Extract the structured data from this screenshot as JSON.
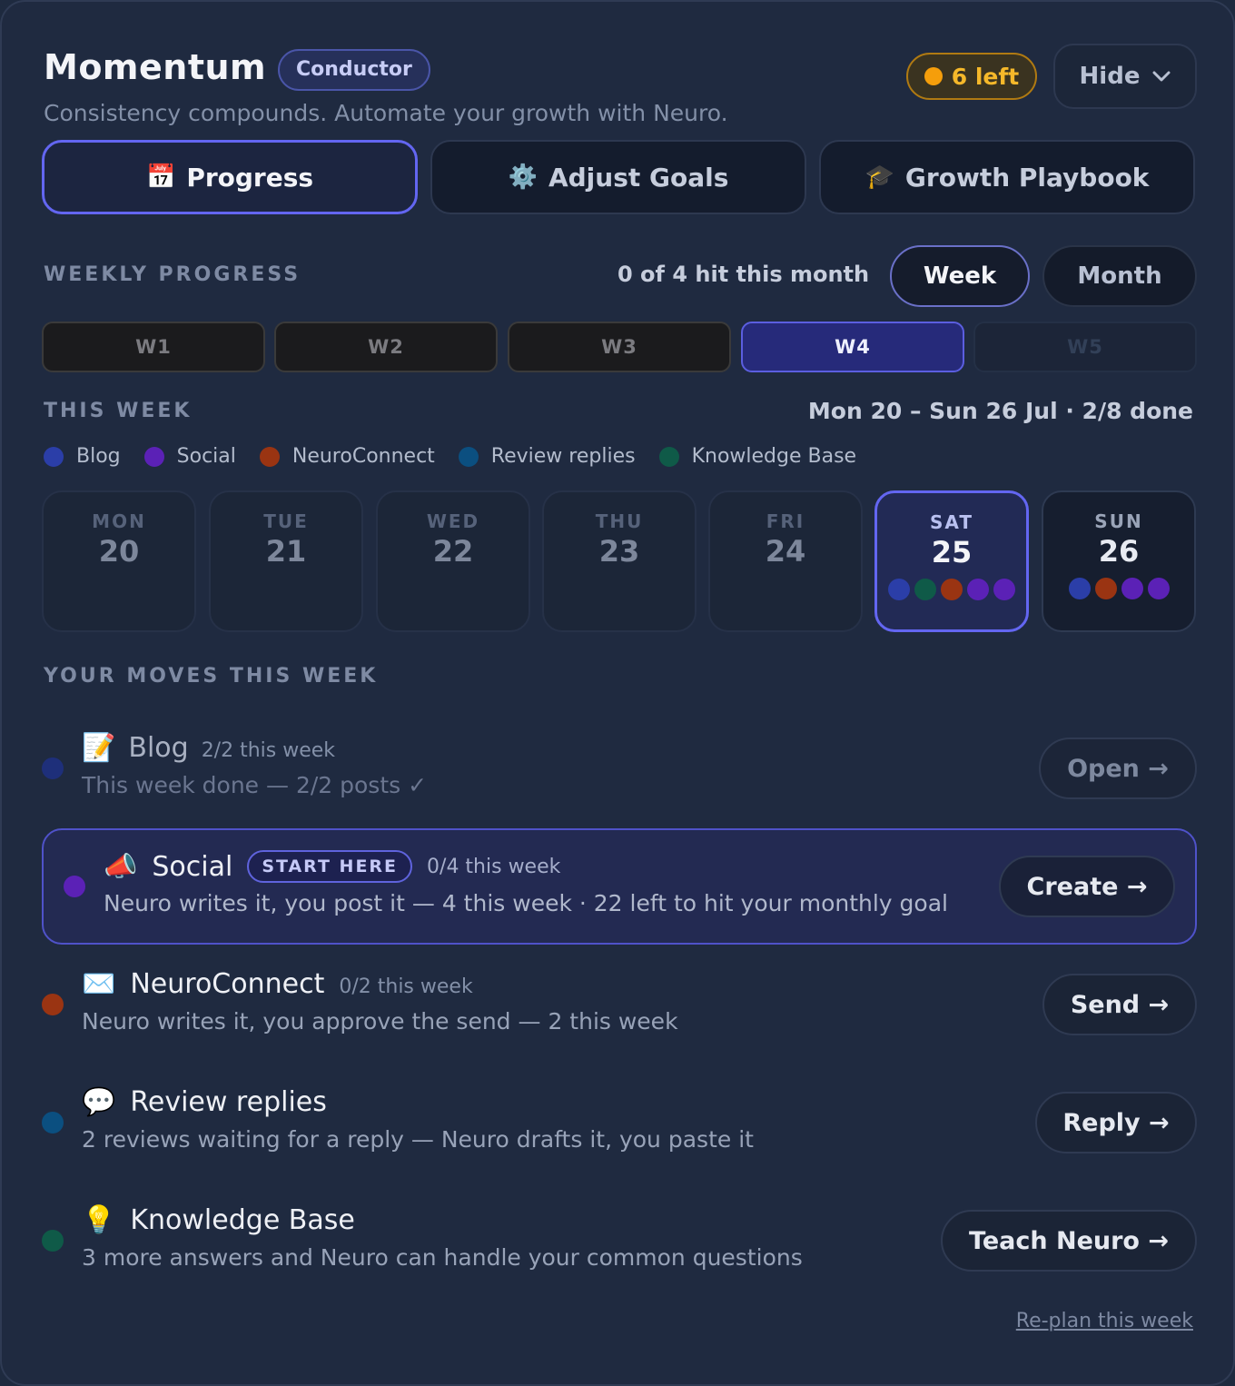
{
  "header": {
    "title": "Momentum",
    "role_badge": "Conductor",
    "subtitle": "Consistency compounds. Automate your growth with Neuro.",
    "left_badge": "6 left",
    "hide_label": "Hide"
  },
  "tabs": [
    {
      "label": "Progress",
      "icon": "📅",
      "active": true
    },
    {
      "label": "Adjust Goals",
      "icon": "⚙️",
      "active": false
    },
    {
      "label": "Growth Playbook",
      "icon": "🎓",
      "active": false
    }
  ],
  "weekly": {
    "label": "WEEKLY PROGRESS",
    "hit_text": "0 of 4 hit this month",
    "toggle_week": "Week",
    "toggle_month": "Month",
    "weeks": [
      "W1",
      "W2",
      "W3",
      "W4",
      "W5"
    ],
    "active_week": "W4"
  },
  "this_week": {
    "label": "THIS WEEK",
    "range": "Mon 20 – Sun 26 Jul · 2/8 done",
    "legend": [
      {
        "label": "Blog",
        "color": "#2b3ea8"
      },
      {
        "label": "Social",
        "color": "#5b21b6"
      },
      {
        "label": "NeuroConnect",
        "color": "#9a3412"
      },
      {
        "label": "Review replies",
        "color": "#0b4f80"
      },
      {
        "label": "Knowledge Base",
        "color": "#0f5a48"
      }
    ],
    "days": [
      {
        "name": "MON",
        "num": "20"
      },
      {
        "name": "TUE",
        "num": "21"
      },
      {
        "name": "WED",
        "num": "22"
      },
      {
        "name": "THU",
        "num": "23"
      },
      {
        "name": "FRI",
        "num": "24"
      },
      {
        "name": "SAT",
        "num": "25"
      },
      {
        "name": "SUN",
        "num": "26"
      }
    ]
  },
  "moves": {
    "label": "YOUR MOVES THIS WEEK",
    "items": [
      {
        "icon": "📝",
        "title": "Blog",
        "count": "2/2 this week",
        "desc": "This week done — 2/2 posts ✓",
        "cta": "Open →",
        "color": "#1e2f7a"
      },
      {
        "icon": "📣",
        "title": "Social",
        "badge": "START HERE",
        "count": "0/4 this week",
        "desc": "Neuro writes it, you post it — 4 this week · 22 left to hit your monthly goal",
        "cta": "Create →",
        "color": "#5b21b6"
      },
      {
        "icon": "✉️",
        "title": "NeuroConnect",
        "count": "0/2 this week",
        "desc": "Neuro writes it, you approve the send — 2 this week",
        "cta": "Send →",
        "color": "#9a3412"
      },
      {
        "icon": "💬",
        "title": "Review replies",
        "count": "",
        "desc": "2 reviews waiting for a reply — Neuro drafts it, you paste it",
        "cta": "Reply →",
        "color": "#0b4f80"
      },
      {
        "icon": "💡",
        "title": "Knowledge Base",
        "count": "",
        "desc": "3 more answers and Neuro can handle your common questions",
        "cta": "Teach Neuro →",
        "color": "#0f5a48"
      }
    ]
  },
  "replan": "Re-plan this week"
}
